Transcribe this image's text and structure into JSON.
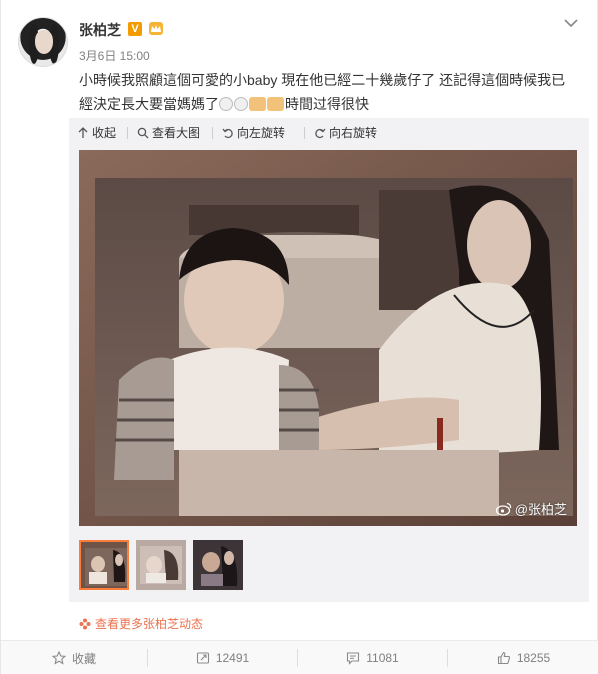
{
  "post": {
    "username": "张柏芝",
    "verified_badge": "V",
    "timestamp": "3月6日 15:00",
    "text_part1": "小時候我照顧這個可愛的小baby 現在他已經二十幾歲仔了 还記得這個時候我已經決定長大要當媽媽了",
    "text_part2": "時間过得很快"
  },
  "media_toolbar": {
    "collapse": "收起",
    "view_large": "查看大图",
    "rotate_left": "向左旋转",
    "rotate_right": "向右旋转"
  },
  "photo": {
    "watermark": "@张柏芝"
  },
  "more_link": "查看更多张柏芝动态",
  "actions": {
    "favorite": "收藏",
    "repost_count": "12491",
    "comment_count": "11081",
    "like_count": "18255"
  },
  "colors": {
    "accent_orange": "#eb7350",
    "verified": "#f49b00",
    "thumb_selected": "#fa7d3c"
  }
}
